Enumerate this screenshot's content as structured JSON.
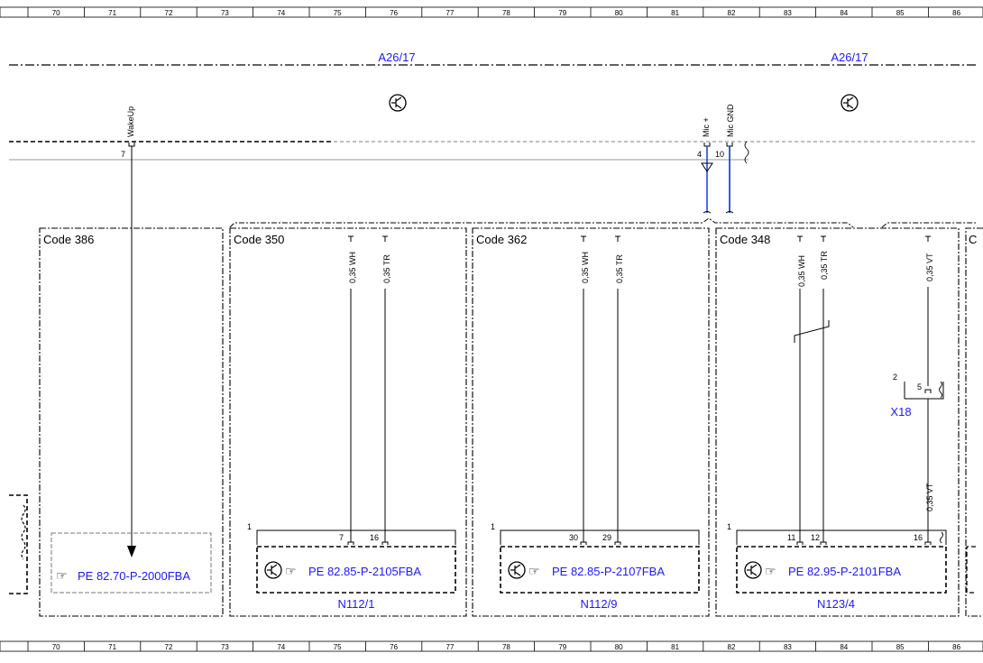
{
  "ruler": {
    "columns": [
      "70",
      "71",
      "72",
      "73",
      "74",
      "75",
      "76",
      "77",
      "78",
      "79",
      "80",
      "81",
      "82",
      "83",
      "84",
      "85",
      "86"
    ]
  },
  "modules": [
    {
      "name": "A26/17"
    },
    {
      "name": "A26/17"
    }
  ],
  "top_signals": {
    "wakeup": {
      "label": "WakeUp",
      "pin": "7"
    },
    "mic_plus": {
      "label": "Mic +",
      "pin": "4"
    },
    "mic_gnd": {
      "label": "Mic GND",
      "pin": "10"
    }
  },
  "code_boxes": [
    {
      "code": "Code 386"
    },
    {
      "code": "Code 350"
    },
    {
      "code": "Code 362"
    },
    {
      "code": "Code 348"
    },
    {
      "code": "C"
    }
  ],
  "wires": {
    "w350_a": "0,35 WH",
    "w350_b": "0,35 TR",
    "w362_a": "0,35 WH",
    "w362_b": "0,35 TR",
    "w348_a": "0,35 WH",
    "w348_b": "0,35 TR",
    "vt_upper": "0,35 VT",
    "vt_lower": "0,35 VT"
  },
  "connectors": {
    "x18": {
      "name": "X18",
      "pin_outer": "2",
      "pin_inner": "5"
    }
  },
  "components": [
    {
      "ref": "PE 82.70-P-2000FBA"
    },
    {
      "ref": "PE 82.85-P-2105FBA",
      "name": "N112/1",
      "pin_header": "1",
      "pin_a": "7",
      "pin_b": "16"
    },
    {
      "ref": "PE 82.85-P-2107FBA",
      "name": "N112/9",
      "pin_header": "1",
      "pin_a": "30",
      "pin_b": "29"
    },
    {
      "ref": "PE 82.95-P-2101FBA",
      "name": "N123/4",
      "pin_header": "1",
      "pin_a": "11",
      "pin_b": "12",
      "pin_c": "16"
    }
  ],
  "colors": {
    "wire": "#000000",
    "mic_wire": "#1a4fd8",
    "label_blue": "#1a1aff"
  }
}
